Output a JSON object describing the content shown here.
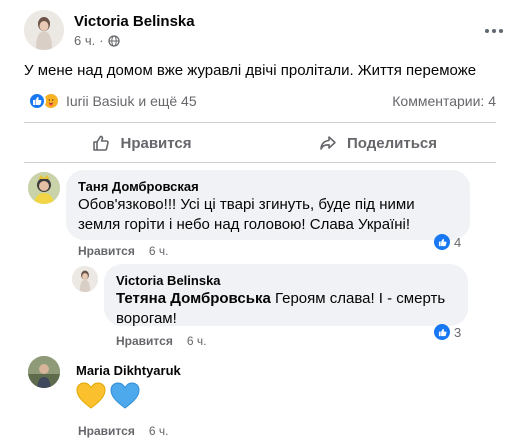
{
  "post": {
    "author": "Victoria Belinska",
    "time": "6 ч.",
    "dot": "·",
    "text": "У мене над домом вже журавлі двічі пролітали. Життя переможе",
    "reactions_text": "Iurii Basiuk и ещё 45",
    "comments_count": "Комментарии: 4",
    "like_label": "Нравится",
    "share_label": "Поделиться"
  },
  "comments": [
    {
      "author": "Таня Домбровская",
      "text": "Обов'язково!!! Усі ці тварі згинуть, буде під ними земля горіти і небо над головою! Слава Україні!",
      "like_label": "Нравится",
      "time": "6 ч.",
      "reaction_count": "4"
    },
    {
      "author": "Victoria Belinska",
      "mention": "Тетяна Домбровська",
      "text": "Героям слава! І - смерть ворогам!",
      "like_label": "Нравится",
      "time": "6 ч.",
      "reaction_count": "3"
    },
    {
      "author": "Maria Dikhtyaruk",
      "text": "💛💙",
      "like_label": "Нравится",
      "time": "6 ч."
    }
  ],
  "colors": {
    "accent": "#1877f2",
    "bubble": "#f0f2f5",
    "secondary_text": "#65676b"
  },
  "icons": [
    "globe-icon",
    "more-icon",
    "like-reaction-icon",
    "care-reaction-icon",
    "thumbs-up-icon",
    "share-icon"
  ]
}
